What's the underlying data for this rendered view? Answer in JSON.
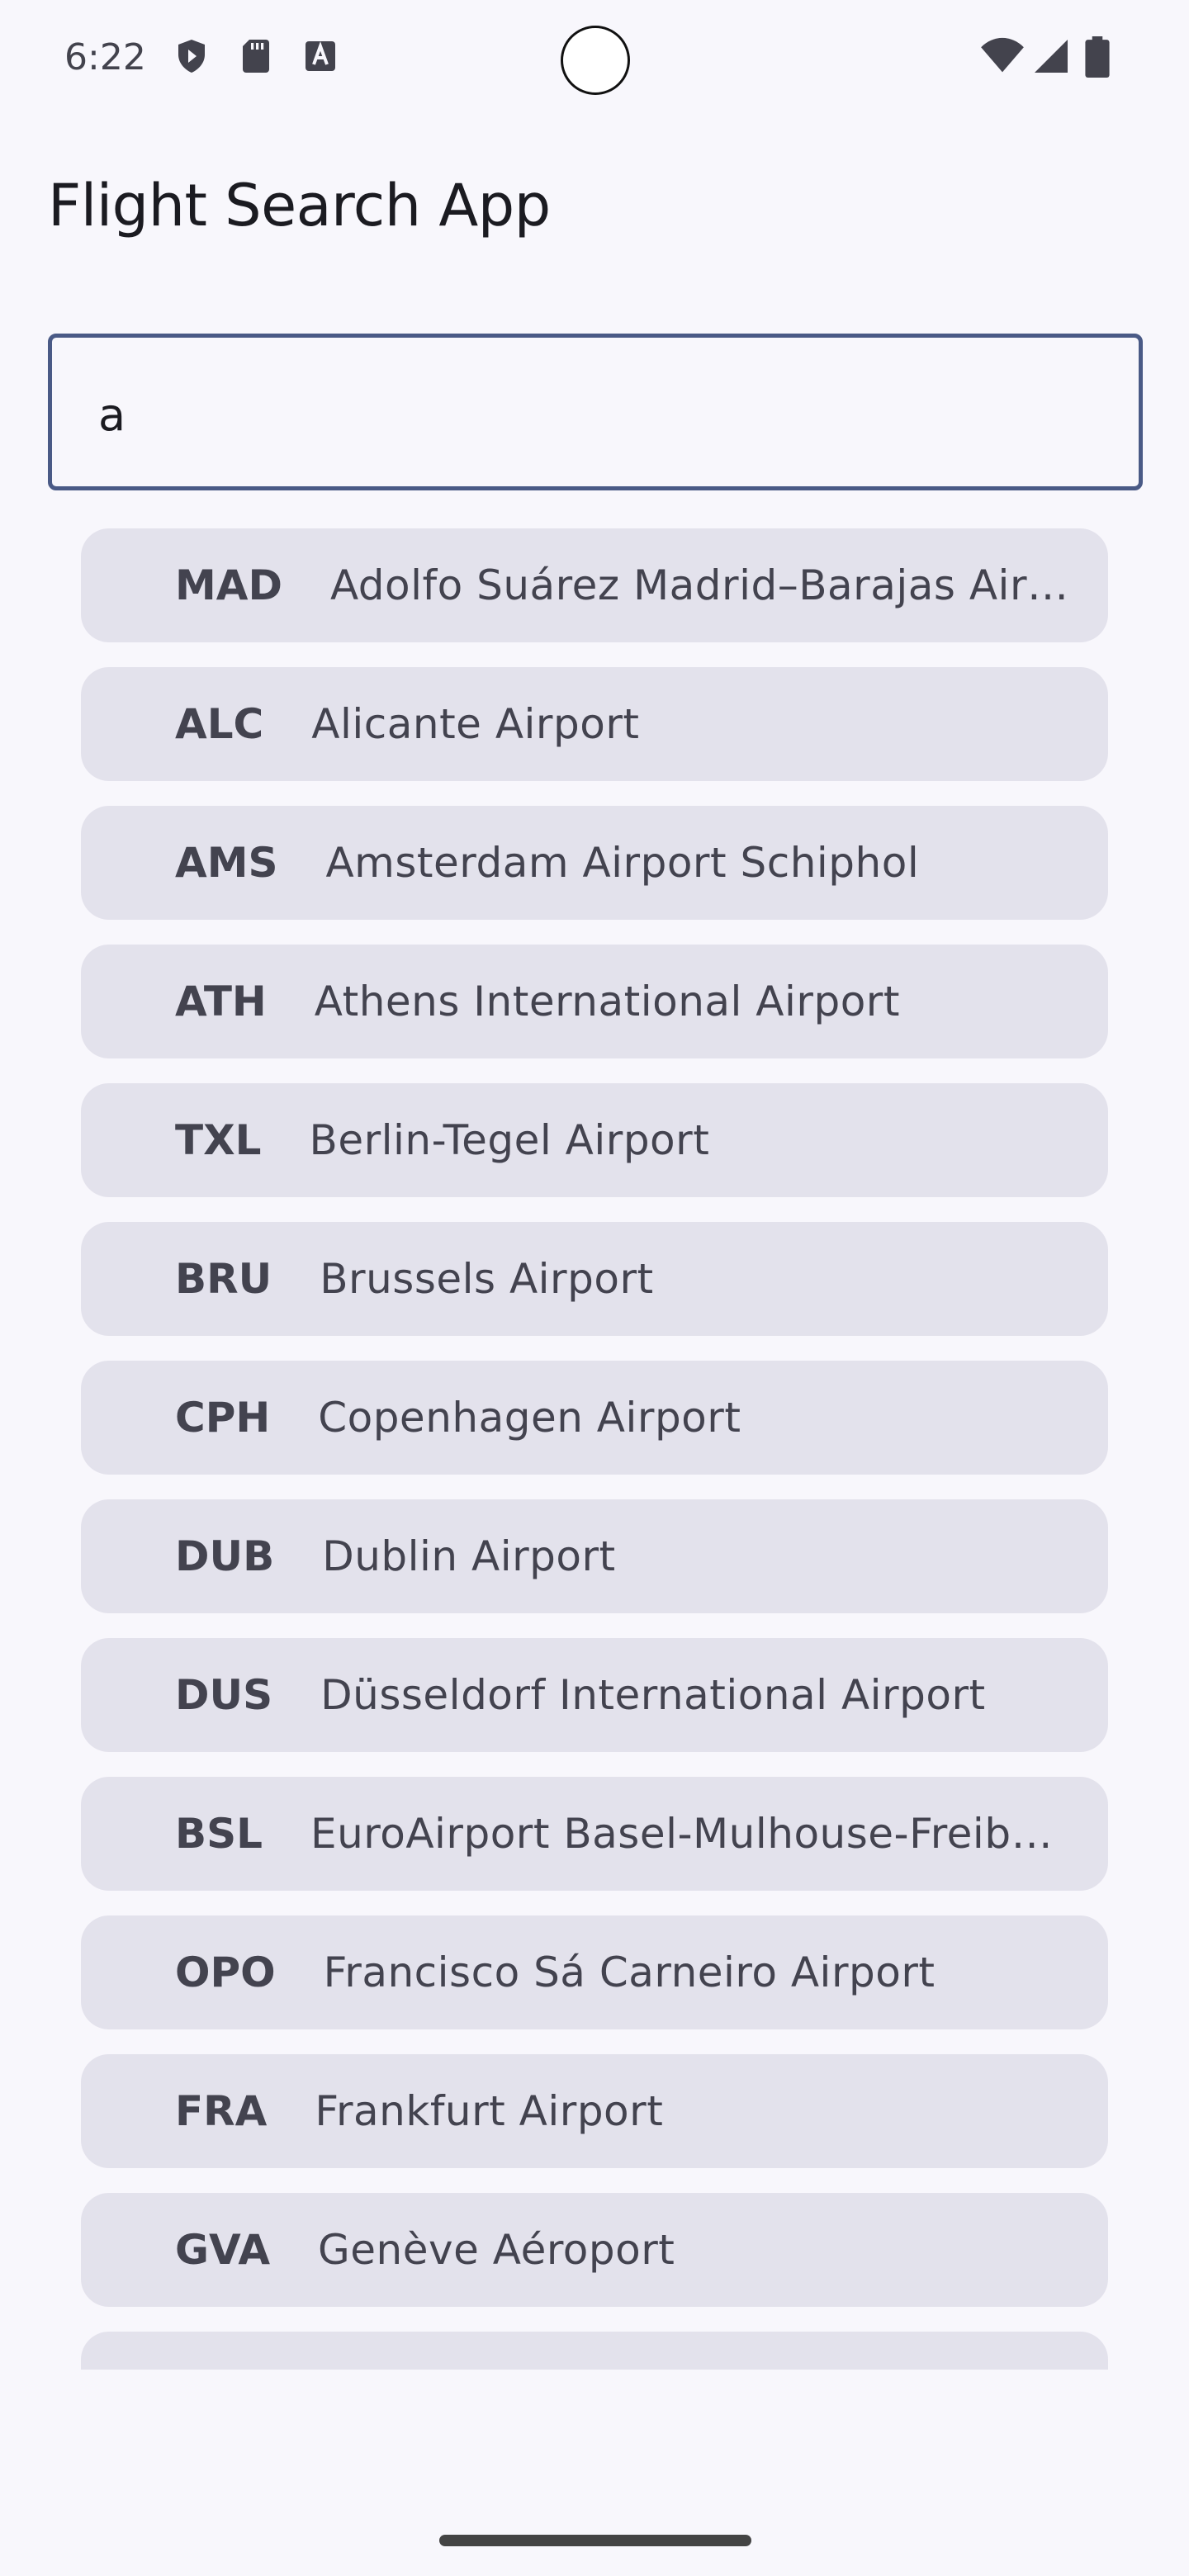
{
  "status_bar": {
    "time": "6:22",
    "left_icons": [
      "shield-icon",
      "sd-card-icon",
      "keyboard-a-icon"
    ],
    "right_icons": [
      "wifi-icon",
      "cell-signal-icon",
      "battery-icon"
    ]
  },
  "header": {
    "title": "Flight Search App"
  },
  "search": {
    "value": "a"
  },
  "results": [
    {
      "code": "MAD",
      "name": "Adolfo Suárez Madrid–Barajas Airport"
    },
    {
      "code": "ALC",
      "name": "Alicante Airport"
    },
    {
      "code": "AMS",
      "name": "Amsterdam Airport Schiphol"
    },
    {
      "code": "ATH",
      "name": "Athens International Airport"
    },
    {
      "code": "TXL",
      "name": "Berlin-Tegel Airport"
    },
    {
      "code": "BRU",
      "name": "Brussels Airport"
    },
    {
      "code": "CPH",
      "name": "Copenhagen Airport"
    },
    {
      "code": "DUB",
      "name": "Dublin Airport"
    },
    {
      "code": "DUS",
      "name": "Düsseldorf International Airport"
    },
    {
      "code": "BSL",
      "name": "EuroAirport Basel-Mulhouse-Freiburg"
    },
    {
      "code": "OPO",
      "name": "Francisco Sá Carneiro Airport"
    },
    {
      "code": "FRA",
      "name": "Frankfurt Airport"
    },
    {
      "code": "GVA",
      "name": "Genève Aéroport"
    },
    {
      "code": "",
      "name": ""
    }
  ]
}
